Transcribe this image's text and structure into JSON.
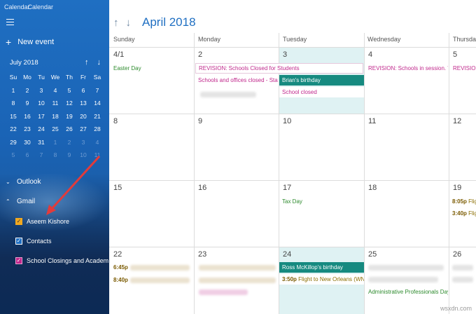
{
  "window": {
    "title": "Calendar"
  },
  "sidebar": {
    "new_event": "New event",
    "mini_calendar": {
      "month": "July 2018",
      "weekdays": [
        "Su",
        "Mo",
        "Tu",
        "We",
        "Th",
        "Fr",
        "Sa"
      ],
      "weeks": [
        [
          "1",
          "2",
          "3",
          "4",
          "5",
          "6",
          "7"
        ],
        [
          "8",
          "9",
          "10",
          "11",
          "12",
          "13",
          "14"
        ],
        [
          "15",
          "16",
          "17",
          "18",
          "19",
          "20",
          "21"
        ],
        [
          "22",
          "23",
          "24",
          "25",
          "26",
          "27",
          "28"
        ],
        [
          "29",
          "30",
          "31",
          "1",
          "2",
          "3",
          "4"
        ],
        [
          "5",
          "6",
          "7",
          "8",
          "9",
          "10",
          "11"
        ]
      ]
    },
    "accounts": {
      "outlook": "Outlook",
      "gmail": "Gmail"
    },
    "calendars": [
      {
        "label": "Aseem Kishore",
        "color": "#f0a820"
      },
      {
        "label": "Contacts",
        "color": "#1f6fc2"
      },
      {
        "label": "School Closings and Academ",
        "color": "#c0288c"
      }
    ]
  },
  "main": {
    "month_title": "April 2018",
    "day_headers": [
      "Sunday",
      "Monday",
      "Tuesday",
      "Wednesday",
      "Thursday"
    ],
    "weeks": [
      [
        "4/1",
        "2",
        "3",
        "4",
        "5"
      ],
      [
        "8",
        "9",
        "10",
        "11",
        "12"
      ],
      [
        "15",
        "16",
        "17",
        "18",
        "19"
      ],
      [
        "22",
        "23",
        "24",
        "25",
        "26"
      ]
    ],
    "events": {
      "easter": "Easter Day",
      "revision_closed": "REVISION: Schools Closed for Students",
      "schools_offices": "Schools and offices closed - State",
      "brian": "Brian's birthday",
      "school_closed": "School closed",
      "revision_session_wed": "REVISION: Schools in session. To b",
      "revision_thu": "REVISION",
      "tax_day": "Tax Day",
      "flight_805_time": "8:05p",
      "flight_805": "Flig",
      "flight_340_time": "3:40p",
      "flight_340": "Flig",
      "time_645": "6:45p",
      "time_840": "8:40p",
      "ross": "Ross McKillop's birthday",
      "flight_350_time": "3:50p",
      "flight_350": "Flight to New Orleans (WN",
      "admin_day": "Administrative Professionals Day"
    }
  },
  "colors": {
    "accent": "#1f6fc2",
    "today_highlight": "#dff2f3",
    "teal_event": "#168a80",
    "magenta_event": "#c0288c",
    "green_event": "#2e8b2e",
    "annotation_arrow": "#e23b3b"
  },
  "watermark": "wsxdn.com"
}
